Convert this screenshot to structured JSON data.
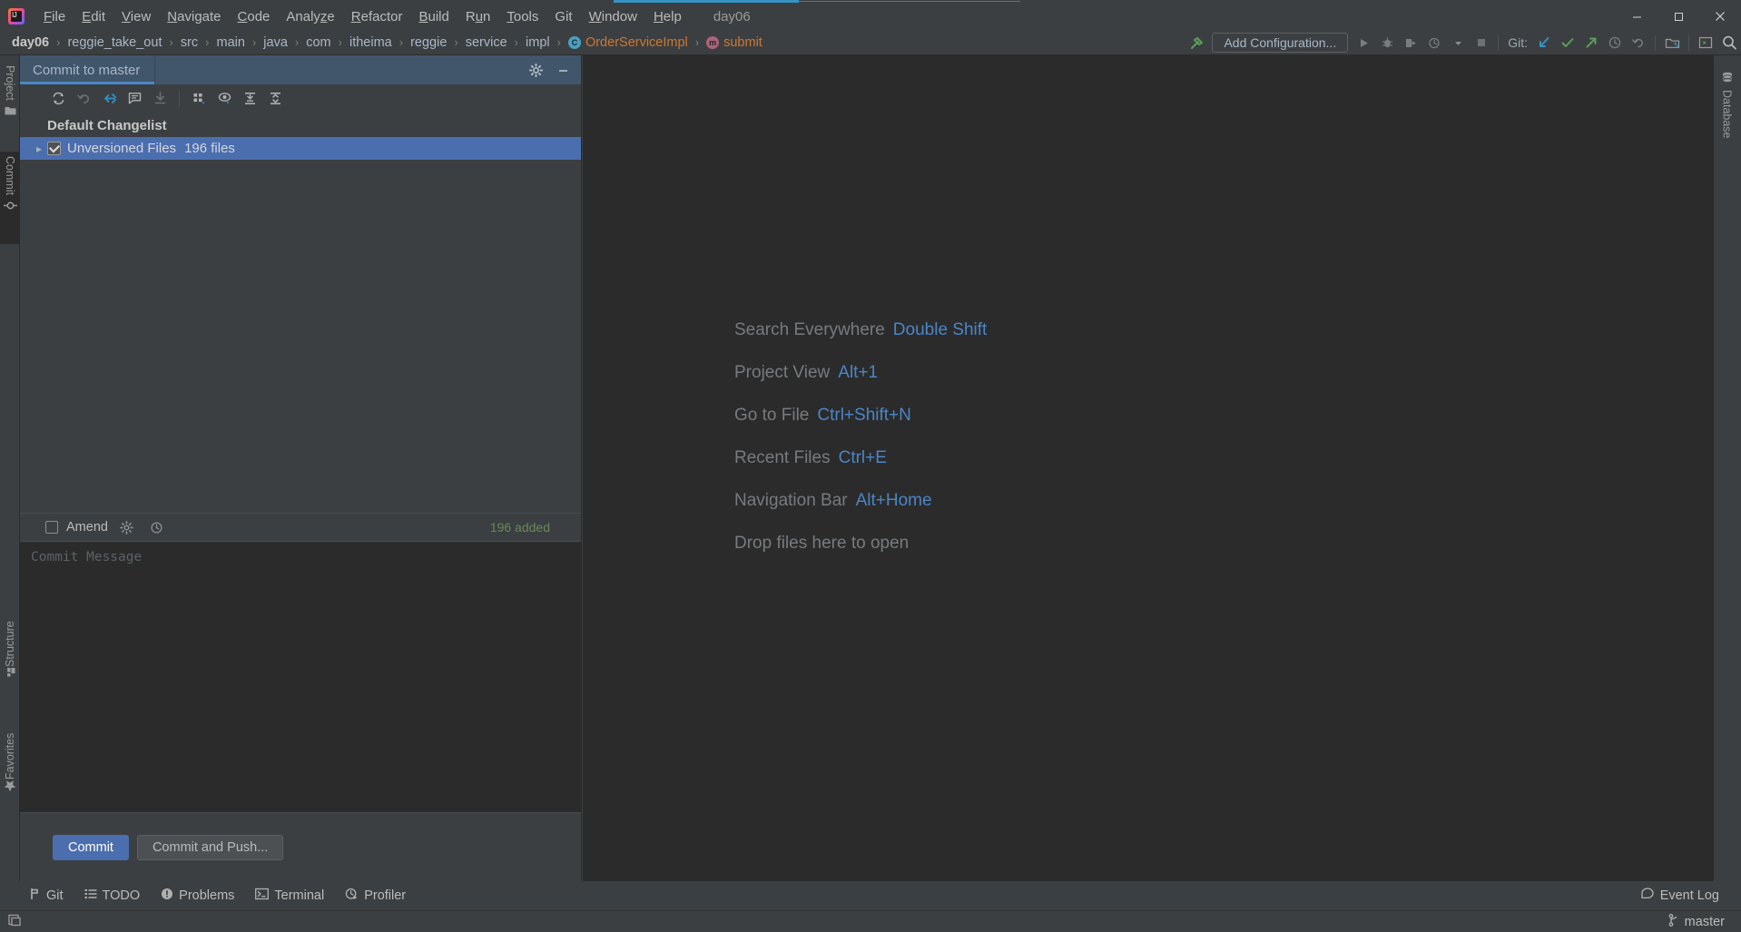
{
  "window": {
    "project_name": "day06",
    "controls": {
      "minimize": "minimize-window",
      "maximize": "maximize-window",
      "close": "close-window"
    }
  },
  "menubar": {
    "app_icon": "intellij-idea-logo",
    "items": [
      {
        "label": "File",
        "mnemonic": "F"
      },
      {
        "label": "Edit",
        "mnemonic": "E"
      },
      {
        "label": "View",
        "mnemonic": "V"
      },
      {
        "label": "Navigate",
        "mnemonic": "N"
      },
      {
        "label": "Code",
        "mnemonic": "C"
      },
      {
        "label": "Analyze",
        "mnemonic": "z"
      },
      {
        "label": "Refactor",
        "mnemonic": "R"
      },
      {
        "label": "Build",
        "mnemonic": "B"
      },
      {
        "label": "Run",
        "mnemonic": "u"
      },
      {
        "label": "Tools",
        "mnemonic": "T"
      },
      {
        "label": "Git",
        "mnemonic": ""
      },
      {
        "label": "Window",
        "mnemonic": "W"
      },
      {
        "label": "Help",
        "mnemonic": "H"
      }
    ]
  },
  "navbar": {
    "crumbs": [
      {
        "label": "day06",
        "style": "bold",
        "icon": ""
      },
      {
        "label": "reggie_take_out",
        "style": "plain",
        "icon": ""
      },
      {
        "label": "src",
        "style": "plain",
        "icon": ""
      },
      {
        "label": "main",
        "style": "plain",
        "icon": ""
      },
      {
        "label": "java",
        "style": "plain",
        "icon": ""
      },
      {
        "label": "com",
        "style": "plain",
        "icon": ""
      },
      {
        "label": "itheima",
        "style": "plain",
        "icon": ""
      },
      {
        "label": "reggie",
        "style": "plain",
        "icon": ""
      },
      {
        "label": "service",
        "style": "plain",
        "icon": ""
      },
      {
        "label": "impl",
        "style": "plain",
        "icon": ""
      },
      {
        "label": "OrderServiceImpl",
        "style": "orange",
        "icon": "class-icon",
        "icon_letter": "C"
      },
      {
        "label": "submit",
        "style": "orange",
        "icon": "method-icon",
        "icon_letter": "m"
      }
    ],
    "separator": "›",
    "build_icon": "hammer-icon",
    "run_config": {
      "label": "Add Configuration..."
    },
    "run_controls": [
      "run-icon",
      "debug-icon",
      "run-with-coverage-icon",
      "profile-icon",
      "dropdown-icon",
      "stop-icon"
    ],
    "git_label": "Git:",
    "git_actions": [
      "update-project-icon",
      "commit-icon",
      "push-icon",
      "history-icon",
      "rollback-icon"
    ],
    "right_actions": [
      "search-everywhere-icon",
      "project-structure-icon",
      "settings-search-icon"
    ]
  },
  "left_tool_strip": {
    "tabs": [
      {
        "label": "Project",
        "icon": "folder-icon",
        "selected": false
      },
      {
        "label": "Commit",
        "icon": "commit-icon",
        "selected": true
      },
      {
        "label": "Structure",
        "icon": "structure-icon",
        "selected": false
      },
      {
        "label": "Favorites",
        "icon": "star-icon",
        "selected": false
      }
    ]
  },
  "right_tool_strip": {
    "tabs": [
      {
        "label": "Database",
        "icon": "database-icon"
      }
    ]
  },
  "commit_panel": {
    "tab_title": "Commit to master",
    "header_actions": [
      "gear-icon",
      "minimize-icon"
    ],
    "toolbar_actions": [
      "refresh-icon",
      "rollback-icon",
      "shelve-silently-icon",
      "show-diff-icon",
      "get-from-vcs-icon",
      "group-by-icon",
      "preview-icon",
      "expand-all-icon",
      "collapse-all-icon"
    ],
    "changelist": {
      "title": "Default Changelist",
      "rows": [
        {
          "label": "Unversioned Files",
          "count": "196 files",
          "checked": true,
          "selected": true,
          "expanded": false
        }
      ]
    },
    "amend": {
      "label": "Amend",
      "checked": false,
      "actions": [
        "gear-icon",
        "history-icon"
      ]
    },
    "added_count": "196 added",
    "commit_message": {
      "placeholder": "Commit Message",
      "value": ""
    },
    "buttons": [
      {
        "label": "Commit",
        "kind": "primary"
      },
      {
        "label": "Commit and Push...",
        "kind": "normal"
      }
    ]
  },
  "editor": {
    "hints": [
      {
        "action": "Search Everywhere",
        "shortcut": "Double Shift"
      },
      {
        "action": "Project View",
        "shortcut": "Alt+1"
      },
      {
        "action": "Go to File",
        "shortcut": "Ctrl+Shift+N"
      },
      {
        "action": "Recent Files",
        "shortcut": "Ctrl+E"
      },
      {
        "action": "Navigation Bar",
        "shortcut": "Alt+Home"
      },
      {
        "action": "Drop files here to open",
        "shortcut": ""
      }
    ]
  },
  "statusbar": {
    "tabs": [
      {
        "label": "Git",
        "icon": "git-branch-icon"
      },
      {
        "label": "TODO",
        "icon": "todo-list-icon"
      },
      {
        "label": "Problems",
        "icon": "problems-icon"
      },
      {
        "label": "Terminal",
        "icon": "terminal-icon"
      },
      {
        "label": "Profiler",
        "icon": "profiler-icon"
      }
    ],
    "event_log": {
      "label": "Event Log",
      "icon": "event-log-icon"
    },
    "branch": {
      "label": "master",
      "icon": "git-branch-icon"
    },
    "layout_icon": "toggle-tool-window-icon"
  },
  "colors": {
    "accent_blue": "#4a88c7",
    "selection_blue": "#4b6eaf",
    "tab_blue": "#41566b",
    "added_green": "#6a8759",
    "breadcrumb_orange": "#cc7832",
    "bg_panel": "#3c3f41",
    "bg_editor": "#2b2b2b"
  }
}
